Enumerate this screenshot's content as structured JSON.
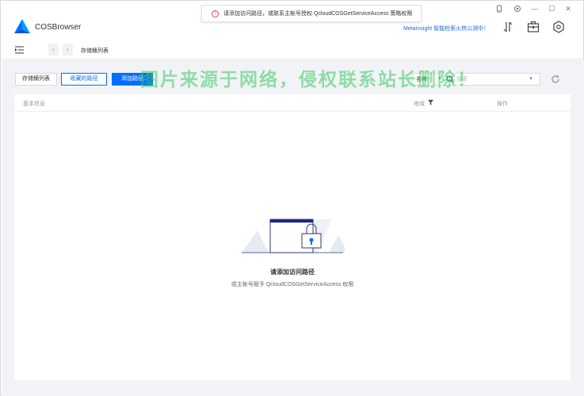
{
  "app": {
    "name": "COSBrowser"
  },
  "toast": {
    "message": "请添加访问路径，或联系主帐号授权 QcloudCOSGetServiceAccess 策略权限"
  },
  "promo": {
    "text": "MetaInsight 智能检索火热公测中！"
  },
  "window_controls": {
    "minimize": "—",
    "maximize": "☐",
    "close": "✕"
  },
  "breadcrumb": {
    "back": "‹",
    "forward": "›",
    "current": "存储桶列表"
  },
  "toolbar": {
    "bucket_list_label": "存储桶列表",
    "favorites_label": "收藏的路径",
    "add_path_label": "添加路径",
    "search_field_label": "名称",
    "search_placeholder": "搜索"
  },
  "table": {
    "columns": [
      "基本信息",
      "地域",
      "操作"
    ]
  },
  "empty_state": {
    "title": "请添加访问路径",
    "description": "或主帐号赋予 QcloudCOSGetServiceAccess 权限"
  },
  "watermark": {
    "text": "图片来源于网络，侵权联系站长删除！"
  },
  "colors": {
    "accent": "#006eff",
    "error": "#e54545",
    "link": "#1a6de0",
    "content_bg": "#f1f3f6"
  },
  "icons": {
    "logo": "cos-logo-icon",
    "phone": "phone-icon",
    "settings": "gear-icon",
    "transfer": "transfer-icon",
    "toolbox": "toolbox-icon",
    "config": "hex-settings-icon",
    "menu": "menu-collapse-icon",
    "search": "search-icon",
    "refresh": "refresh-icon",
    "filter": "filter-icon",
    "empty": "locked-folder-illustration"
  }
}
